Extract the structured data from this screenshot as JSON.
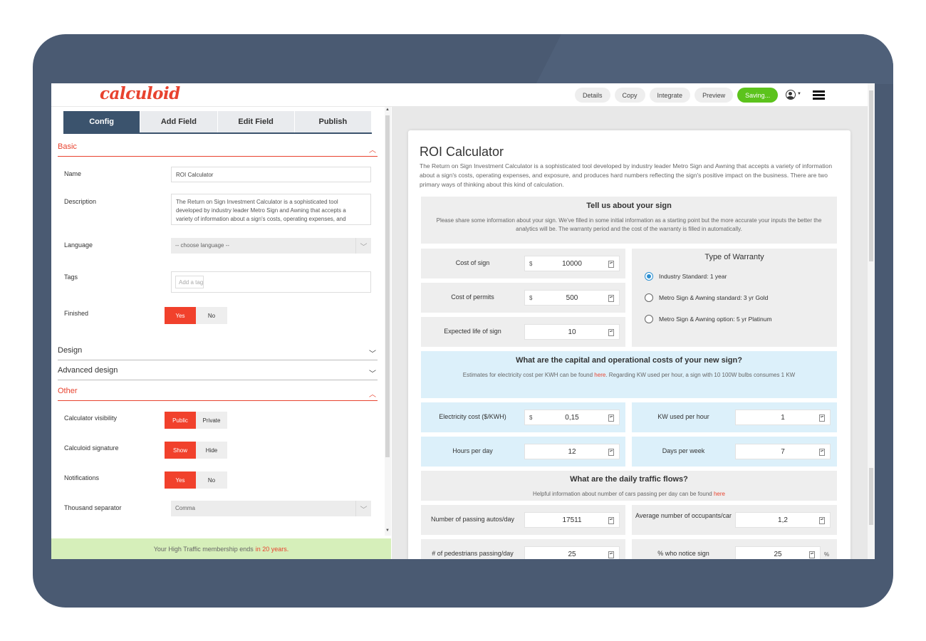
{
  "app": {
    "logo": "calculoid"
  },
  "toolbar": {
    "buttons": [
      "Details",
      "Copy",
      "Integrate",
      "Preview"
    ],
    "saving_label": "Saving..."
  },
  "tabs": [
    "Config",
    "Add Field",
    "Edit Field",
    "Publish"
  ],
  "sections": {
    "basic": "Basic",
    "design": "Design",
    "advanced_design": "Advanced design",
    "other": "Other"
  },
  "basic": {
    "name_label": "Name",
    "name_value": "ROI Calculator",
    "description_label": "Description",
    "description_value": "The Return on Sign Investment Calculator is a sophisticated tool developed by industry leader Metro Sign and Awning that accepts a variety of information about a sign's costs, operating expenses, and",
    "language_label": "Language",
    "language_value": "-- choose language --",
    "tags_label": "Tags",
    "tags_placeholder": "Add a tag",
    "finished_label": "Finished",
    "finished_options": [
      "Yes",
      "No"
    ]
  },
  "other": {
    "visibility_label": "Calculator visibility",
    "visibility_options": [
      "Public",
      "Private"
    ],
    "signature_label": "Calculoid signature",
    "signature_options": [
      "Show",
      "Hide"
    ],
    "notifications_label": "Notifications",
    "notifications_options": [
      "Yes",
      "No"
    ],
    "separator_label": "Thousand separator",
    "separator_value": "Comma"
  },
  "membership": {
    "text": "Your High Traffic membership ends",
    "highlight": "in 20 years."
  },
  "calculator": {
    "title": "ROI Calculator",
    "description": "The Return on Sign Investment Calculator is a sophisticated tool developed by industry leader Metro Sign and Awning that accepts a variety of information about a sign's costs, operating expenses, and exposure, and produces hard numbers reflecting the sign's positive impact on the business. There are two primary ways of thinking about this kind of calculation.",
    "sign_section": {
      "title": "Tell us about your sign",
      "text": "Please share some information about your sign. We've filled in some initial information as a starting point but the more accurate your inputs the better the analytics will be. The warranty period and the cost of the warranty is filled in automatically."
    },
    "currency": "$",
    "cost_of_sign": {
      "label": "Cost of sign",
      "value": "10000"
    },
    "cost_of_permits": {
      "label": "Cost of permits",
      "value": "500"
    },
    "expected_life": {
      "label": "Expected life of sign",
      "value": "10"
    },
    "warranty": {
      "title": "Type of Warranty",
      "options": [
        "Industry Standard: 1 year",
        "Metro Sign & Awning standard: 3 yr Gold",
        "Metro Sign & Awning option: 5 yr Platinum"
      ]
    },
    "costs_section": {
      "title": "What are the capital and operational costs of your new sign?",
      "text_before": "Estimates for electricity cost per KWH can be found",
      "link": "here",
      "text_after": ". Regarding KW used per hour, a sign with 10 100W bulbs consumes 1 KW"
    },
    "electricity_cost": {
      "label": "Electricity cost ($/KWH)",
      "value": "0,15"
    },
    "kw_used": {
      "label": "KW used per hour",
      "value": "1"
    },
    "hours_per_day": {
      "label": "Hours per day",
      "value": "12"
    },
    "days_per_week": {
      "label": "Days per week",
      "value": "7"
    },
    "traffic_section": {
      "title": "What are the daily traffic flows?",
      "text": "Helpful information about number of cars passing per day can be found",
      "link": "here"
    },
    "passing_autos": {
      "label": "Number of passing autos/day",
      "value": "17511"
    },
    "occupants": {
      "label": "Average number of occupants/car",
      "value": "1,2"
    },
    "pedestrians": {
      "label": "# of pedestrians passing/day",
      "value": "25"
    },
    "notice_sign": {
      "label": "% who notice sign",
      "value": "25",
      "unit": "%"
    }
  }
}
